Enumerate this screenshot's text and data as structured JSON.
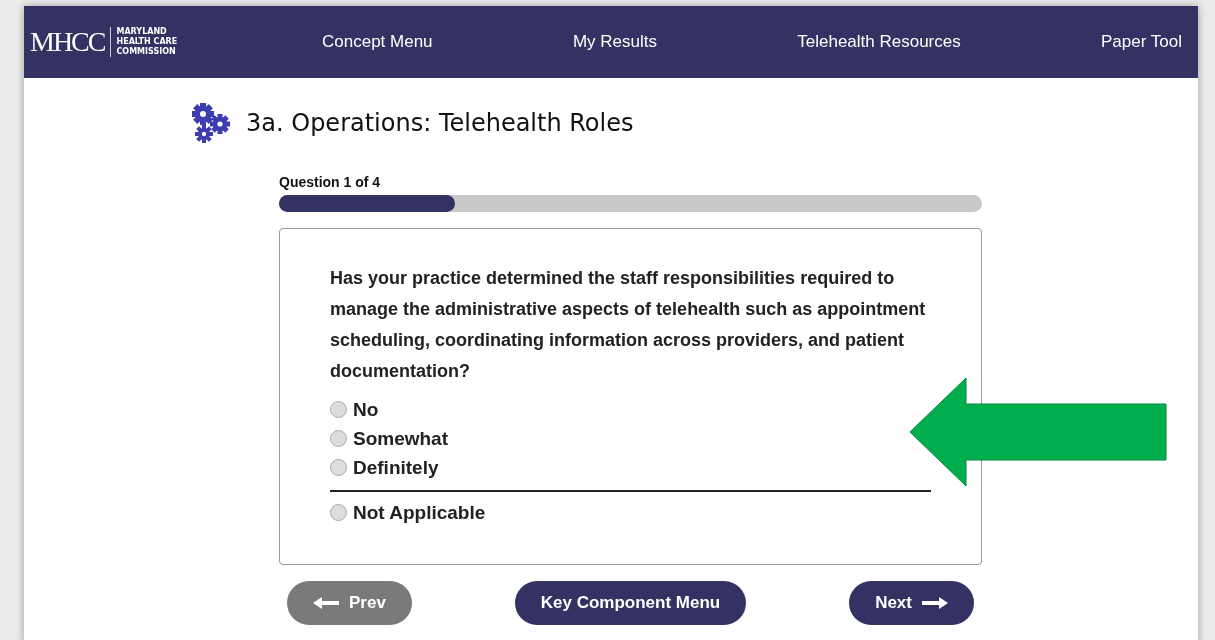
{
  "logo": {
    "mark": "MHCC",
    "lines": [
      "MARYLAND",
      "HEALTH CARE",
      "COMMISSION"
    ]
  },
  "nav": [
    {
      "label": "Concept Menu"
    },
    {
      "label": "My Results"
    },
    {
      "label": "Telehealth Resources"
    },
    {
      "label": "Paper Tool"
    }
  ],
  "page_title": "3a. Operations: Telehealth Roles",
  "progress": {
    "label": "Question 1 of 4",
    "level": 0.25
  },
  "question": "Has your practice determined the staff responsibilities required to manage the administrative aspects of telehealth such as appointment scheduling, coordinating information across providers, and patient documentation?",
  "options": [
    {
      "label": "No",
      "selected": false
    },
    {
      "label": "Somewhat",
      "selected": false
    },
    {
      "label": "Definitely",
      "selected": false
    }
  ],
  "extra_options": [
    {
      "label": "Not Applicable",
      "selected": false
    }
  ],
  "buttons": [
    {
      "label": "Prev",
      "kind": "prev",
      "disabled": true
    },
    {
      "label": "Key Component Menu",
      "kind": "menu",
      "disabled": false
    },
    {
      "label": "Next",
      "kind": "next",
      "disabled": false
    }
  ]
}
